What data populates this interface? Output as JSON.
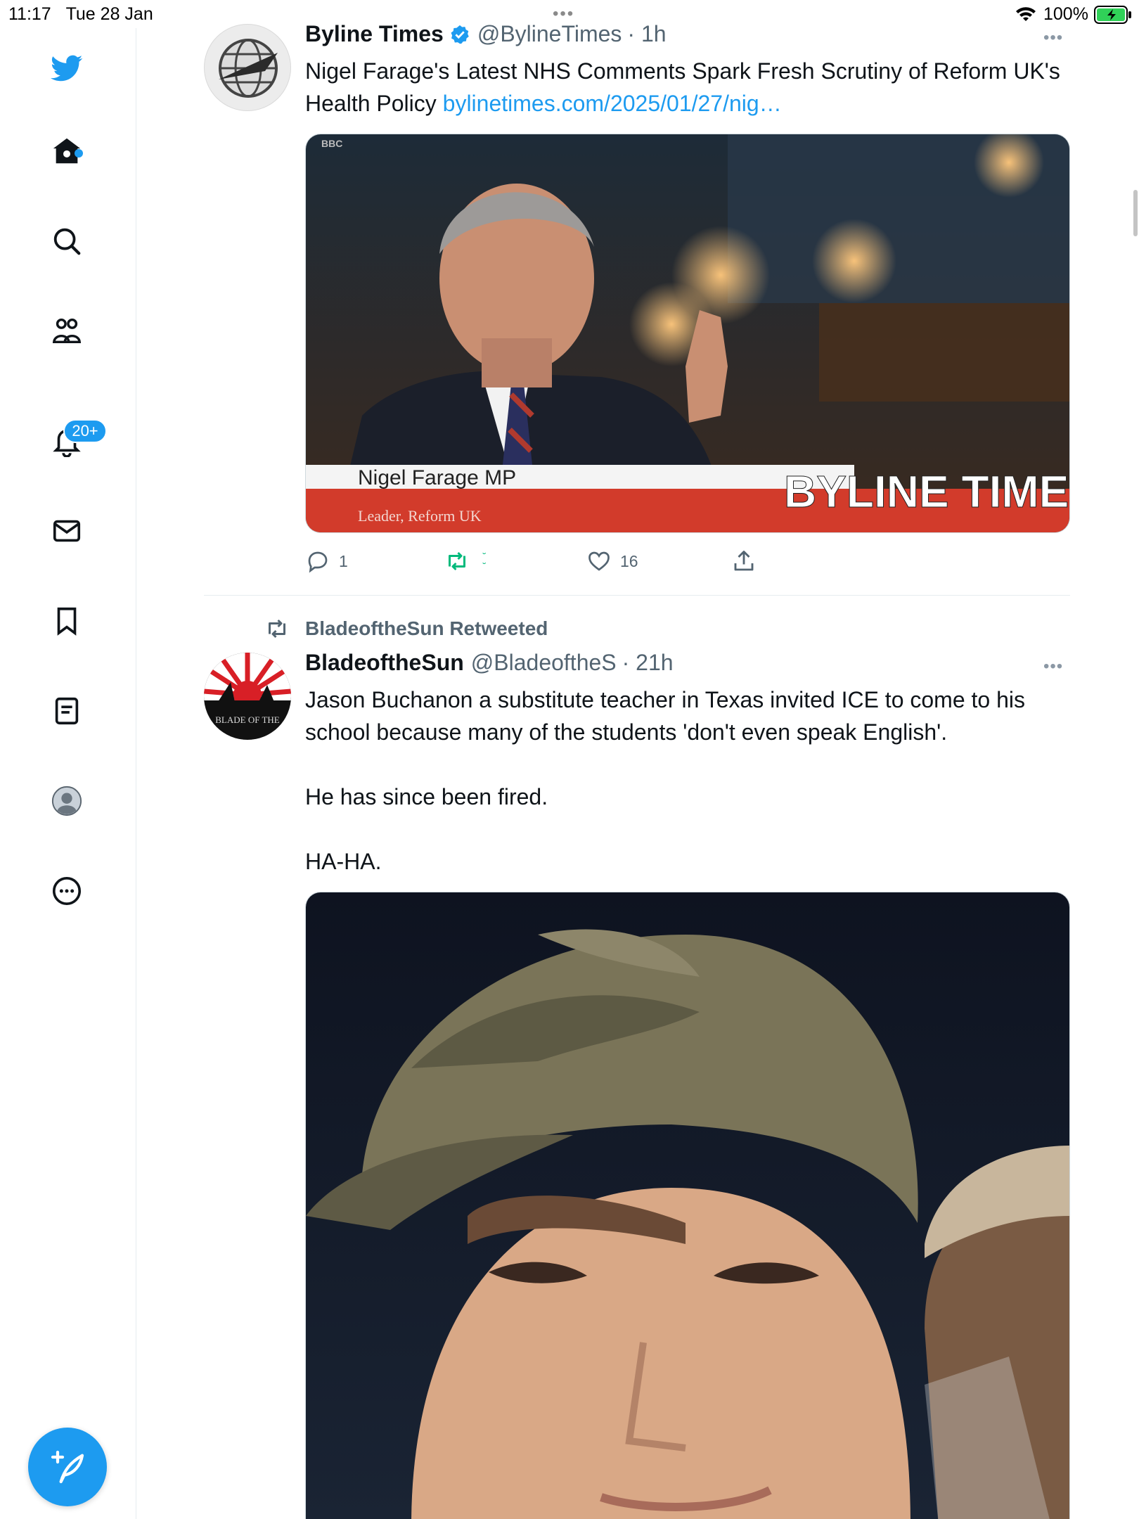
{
  "status_bar": {
    "time": "11:17",
    "date": "Tue 28 Jan",
    "battery": "100%"
  },
  "sidebar": {
    "items": [
      {
        "name": "home",
        "icon": "home-icon"
      },
      {
        "name": "explore",
        "icon": "search-icon"
      },
      {
        "name": "communities",
        "icon": "communities-icon"
      },
      {
        "name": "notifications",
        "icon": "bell-icon",
        "badge": "20+"
      },
      {
        "name": "messages",
        "icon": "mail-icon"
      },
      {
        "name": "bookmarks",
        "icon": "bookmark-icon"
      },
      {
        "name": "lists",
        "icon": "list-icon"
      },
      {
        "name": "profile",
        "icon": "avatar-icon"
      },
      {
        "name": "more",
        "icon": "more-circle-icon"
      }
    ],
    "compose_icon": "compose-tweet-icon"
  },
  "tweets": [
    {
      "name": "Byline Times",
      "verified": true,
      "handle": "@BylineTimes",
      "time": "· 1h",
      "text": "Nigel Farage's Latest NHS Comments Spark Fresh Scrutiny of Reform UK's Health Policy ",
      "link": "bylinetimes.com/2025/01/27/nig…",
      "media": {
        "lower_third_name": "Nigel Farage MP",
        "lower_third_role": "Leader, Reform UK",
        "broadcaster": "BBC",
        "watermark": "BYLINE TIMES"
      },
      "replies": "1",
      "retweets": "",
      "likes": "16"
    },
    {
      "retweeted_by": "BladeoftheSun Retweeted",
      "name": "BladeoftheSun",
      "handle": "@BladeoftheS",
      "time": "· 21h",
      "avatar_text": "BLADE OF THE",
      "text_lines": [
        "Jason Buchanon a substitute teacher in Texas invited ICE to come to his school because many of the students 'don't even speak English'.",
        "He has since been fired.",
        "HA-HA."
      ]
    }
  ],
  "colors": {
    "accent": "#1d9bf0",
    "retweet_green": "#00ba7c",
    "text_secondary": "#536471"
  }
}
